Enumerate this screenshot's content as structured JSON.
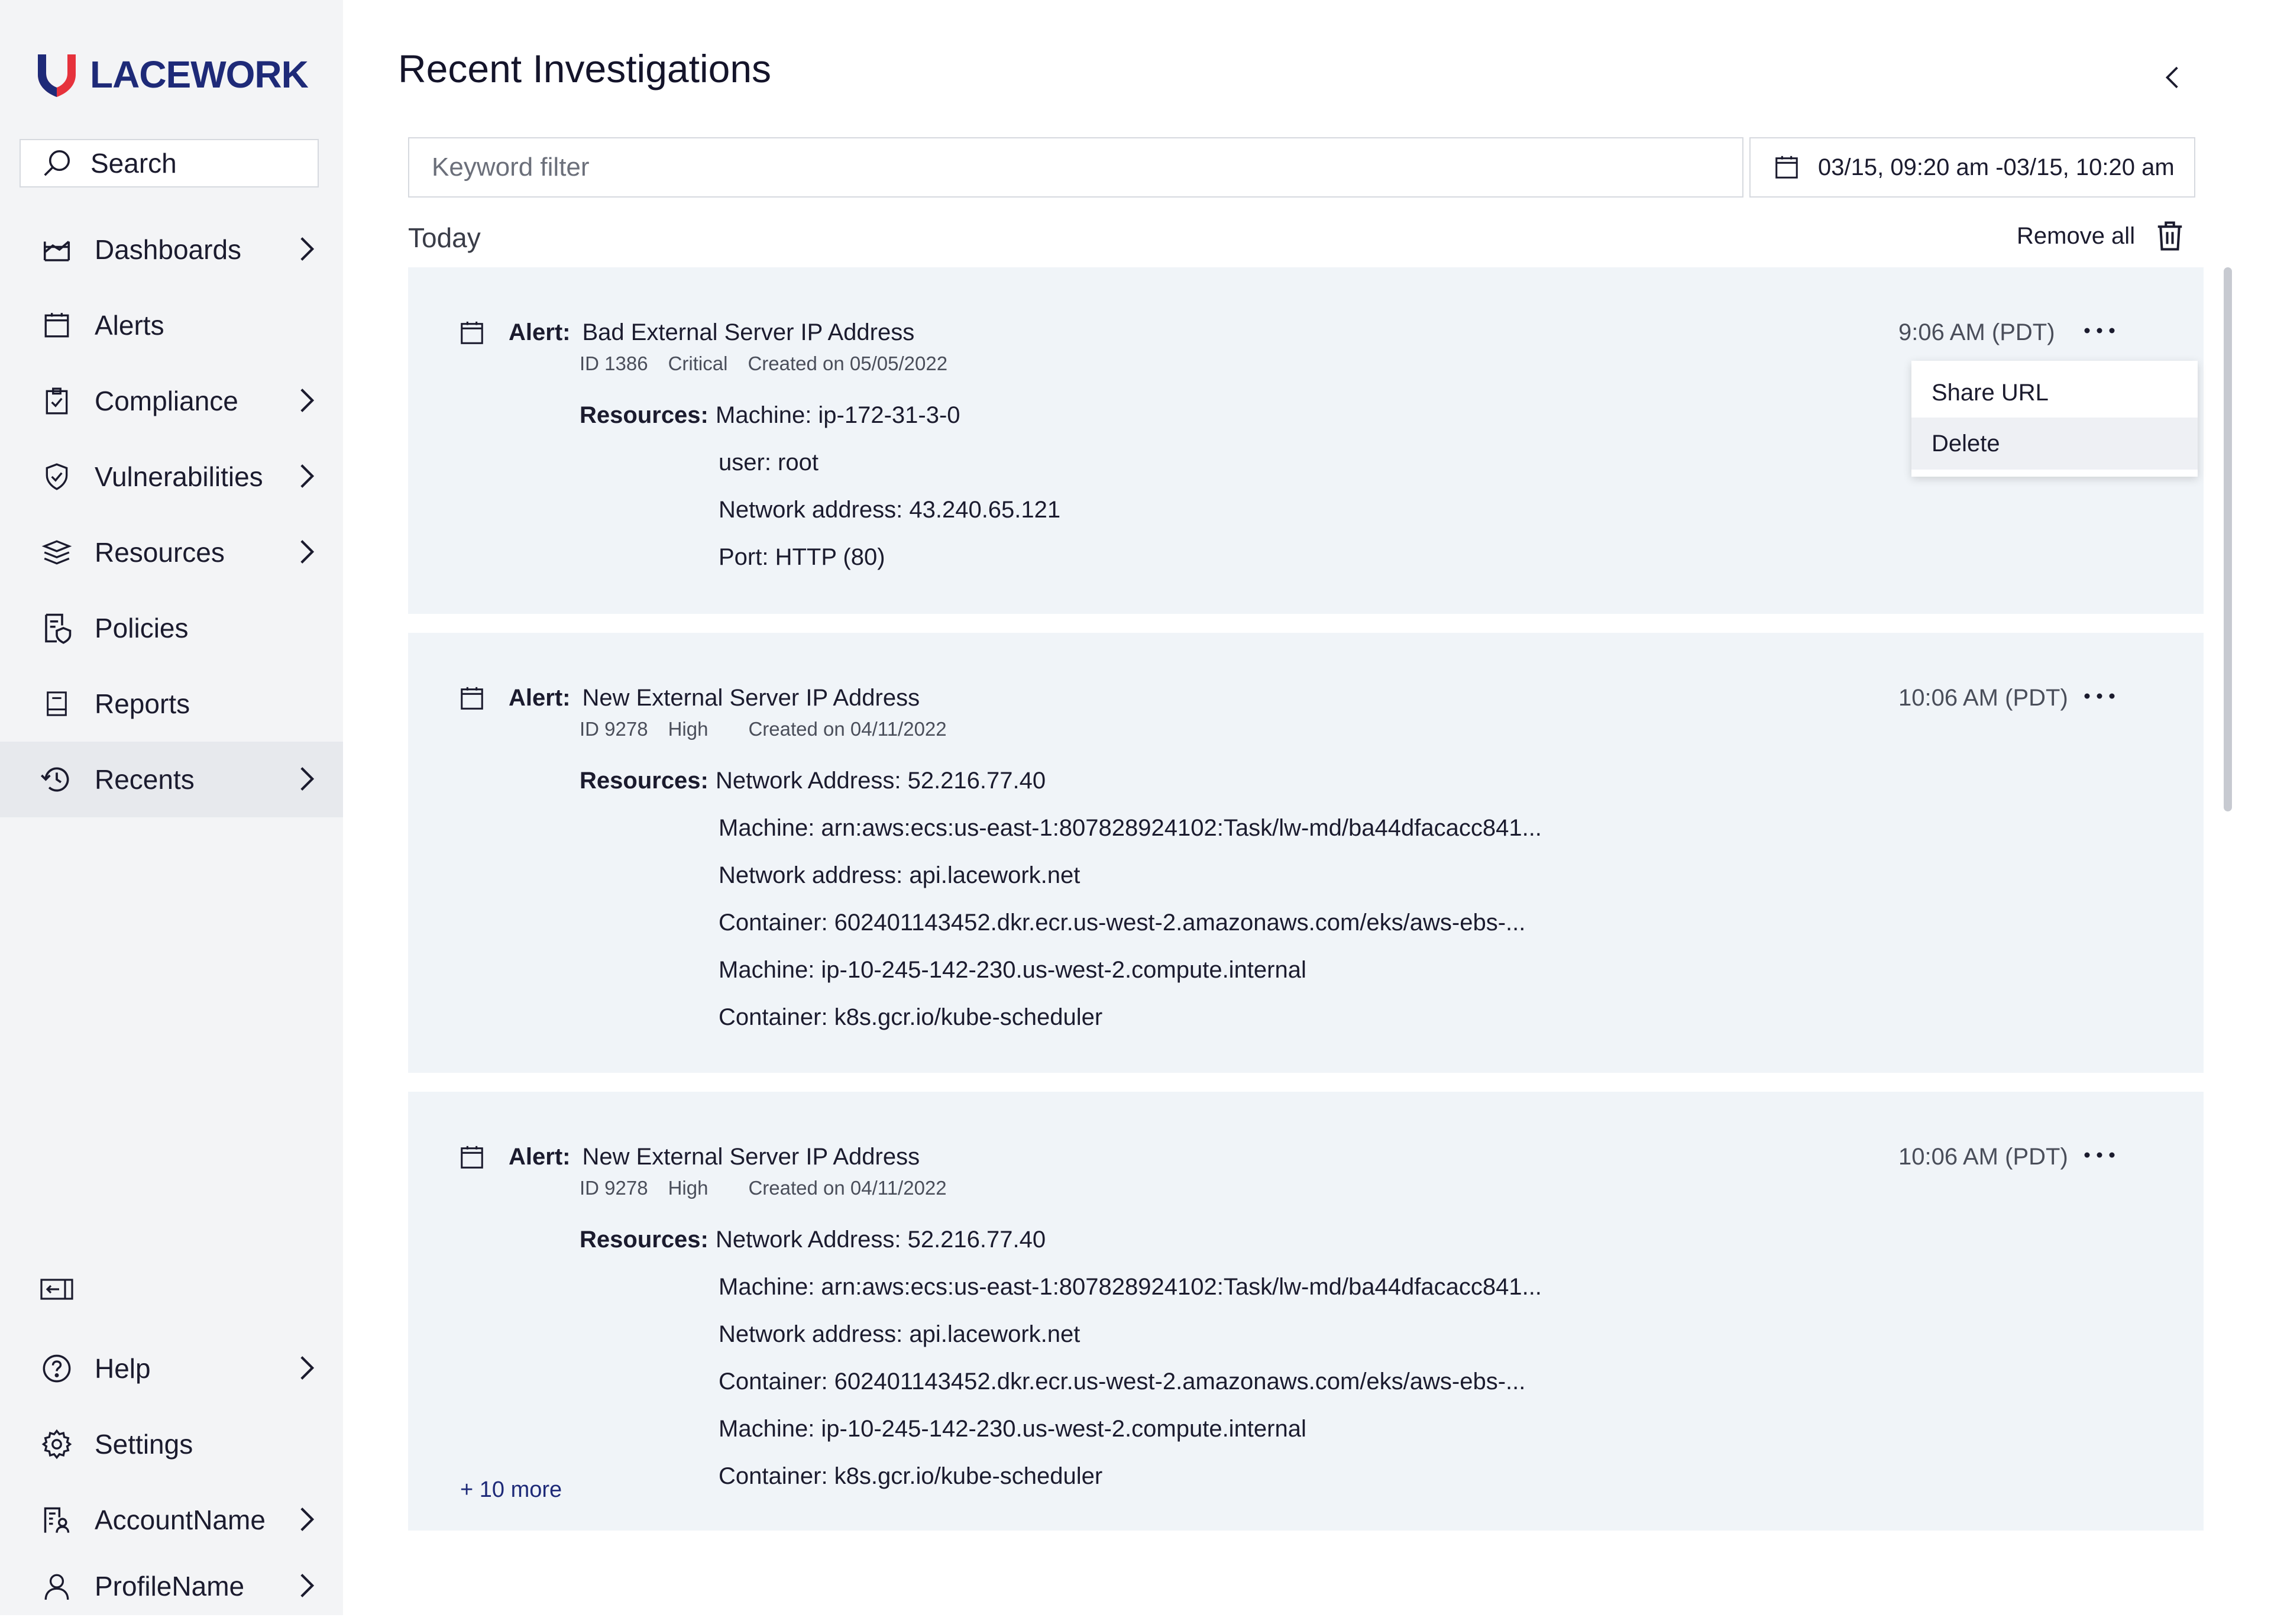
{
  "brand": {
    "name": "LACEWORK",
    "accent": "#1e2a78",
    "logo_red": "#e6323c"
  },
  "sidebar": {
    "search_label": "Search",
    "items": [
      {
        "label": "Dashboards",
        "icon": "dashboard-icon",
        "chevron": true
      },
      {
        "label": "Alerts",
        "icon": "calendar-icon",
        "chevron": false
      },
      {
        "label": "Compliance",
        "icon": "clipboard-check-icon",
        "chevron": true
      },
      {
        "label": "Vulnerabilities",
        "icon": "shield-check-icon",
        "chevron": true
      },
      {
        "label": "Resources",
        "icon": "layers-icon",
        "chevron": true
      },
      {
        "label": "Policies",
        "icon": "policy-icon",
        "chevron": false
      },
      {
        "label": "Reports",
        "icon": "report-icon",
        "chevron": false
      },
      {
        "label": "Recents",
        "icon": "history-icon",
        "chevron": true,
        "active": true
      }
    ],
    "bottom": [
      {
        "label": "Help",
        "icon": "help-icon",
        "chevron": true
      },
      {
        "label": "Settings",
        "icon": "gear-icon",
        "chevron": false
      },
      {
        "label": "AccountName",
        "icon": "account-icon",
        "chevron": true
      },
      {
        "label": "ProfileName",
        "icon": "user-icon",
        "chevron": true
      }
    ]
  },
  "main": {
    "title": "Recent Investigations",
    "keyword_placeholder": "Keyword filter",
    "date_range": "03/15, 09:20 am -03/15, 10:20 am",
    "group_label": "Today",
    "remove_all": "Remove all",
    "resources_label": "Resources:",
    "alert_prefix": "Alert:",
    "menu": {
      "share": "Share URL",
      "delete": "Delete"
    },
    "cards": [
      {
        "title": "Bad External Server IP Address",
        "id": "ID 1386",
        "severity": "Critical",
        "created": "Created on 05/05/2022",
        "time": "9:06 AM (PDT)",
        "resources": [
          "Machine: ip-172-31-3-0",
          "user: root",
          "Network address: 43.240.65.121",
          "Port: HTTP (80)"
        ]
      },
      {
        "title": "New External Server IP Address",
        "id": "ID 9278",
        "severity": "High",
        "created": "Created on 04/11/2022",
        "time": "10:06 AM (PDT)",
        "resources": [
          "Network Address: 52.216.77.40",
          "Machine: arn:aws:ecs:us-east-1:807828924102:Task/lw-md/ba44dfacacc841...",
          "Network address: api.lacework.net",
          "Container: 602401143452.dkr.ecr.us-west-2.amazonaws.com/eks/aws-ebs-...",
          "Machine: ip-10-245-142-230.us-west-2.compute.internal",
          "Container: k8s.gcr.io/kube-scheduler"
        ]
      },
      {
        "title": "New External Server IP Address",
        "id": "ID 9278",
        "severity": "High",
        "created": "Created on 04/11/2022",
        "time": "10:06 AM (PDT)",
        "resources": [
          "Network Address: 52.216.77.40",
          "Machine: arn:aws:ecs:us-east-1:807828924102:Task/lw-md/ba44dfacacc841...",
          "Network address: api.lacework.net",
          "Container: 602401143452.dkr.ecr.us-west-2.amazonaws.com/eks/aws-ebs-...",
          "Machine: ip-10-245-142-230.us-west-2.compute.internal",
          "Container: k8s.gcr.io/kube-scheduler"
        ],
        "more_link": "+ 10 more"
      }
    ]
  }
}
